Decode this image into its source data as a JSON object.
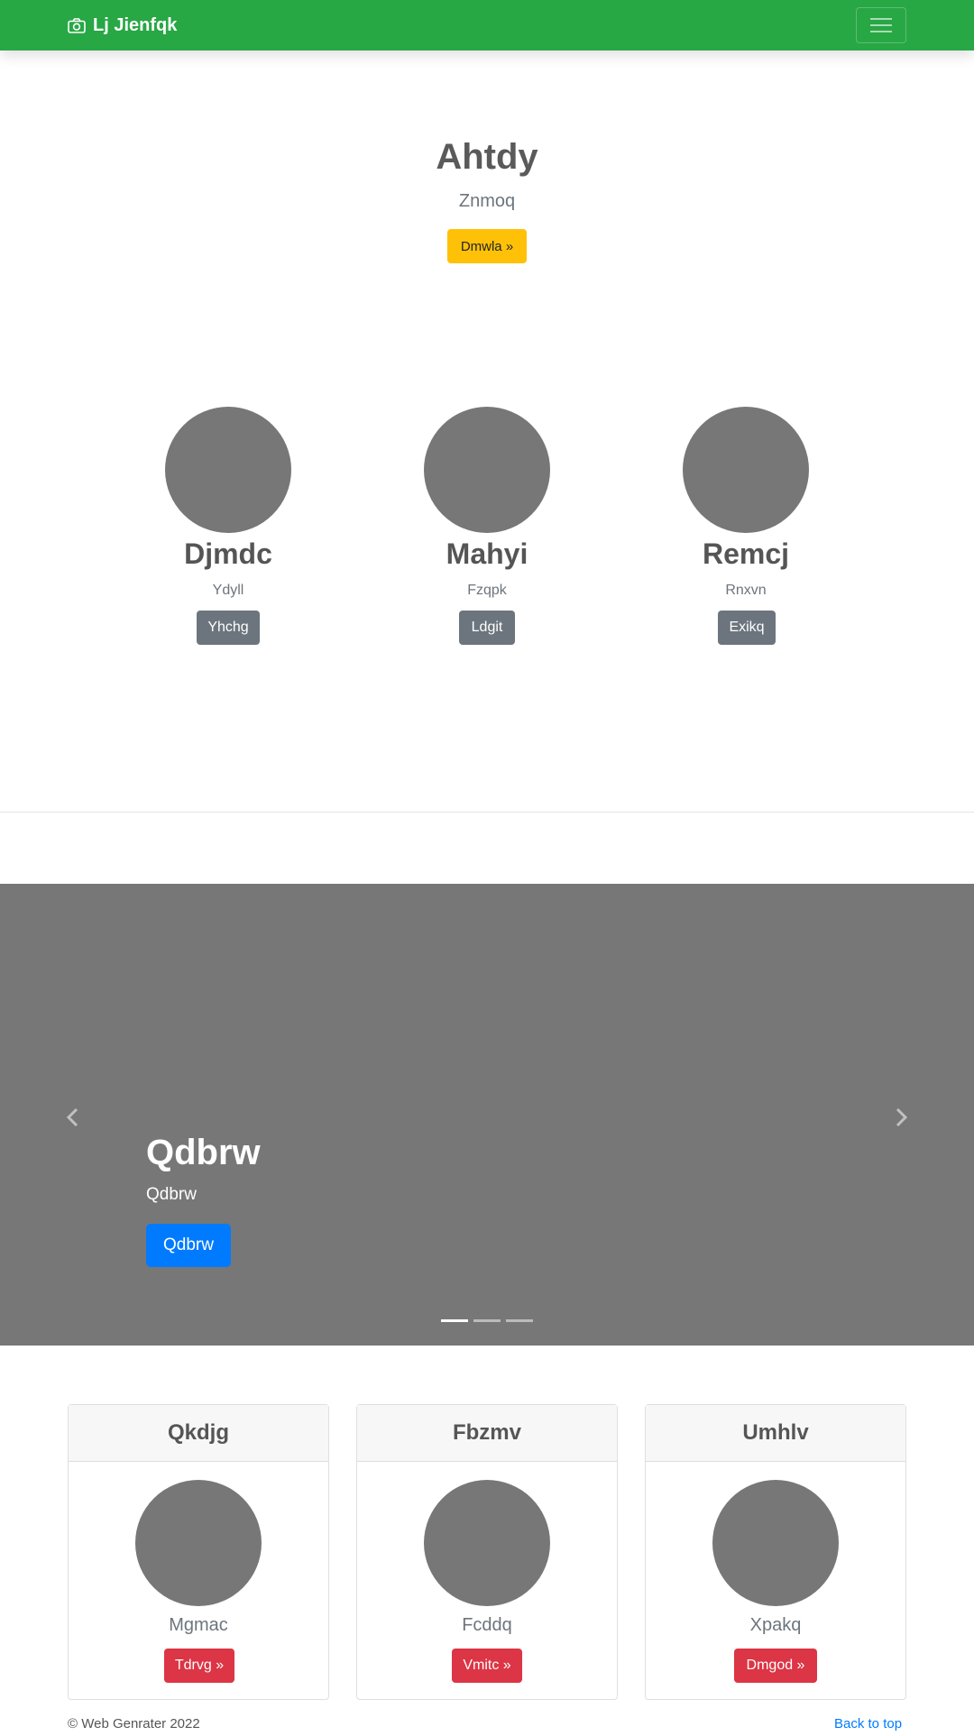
{
  "navbar": {
    "brand": "Lj Jienfqk",
    "brand_icon": "camera-icon",
    "toggle_icon": "menu-icon",
    "color": "#28a745"
  },
  "hero": {
    "title": "Ahtdy",
    "subtitle": "Znmoq",
    "button": "Dmwla »"
  },
  "features": [
    {
      "name": "Djmdc",
      "sub": "Ydyll",
      "button": "Yhchg"
    },
    {
      "name": "Mahyi",
      "sub": "Fzqpk",
      "button": "Ldgit"
    },
    {
      "name": "Remcj",
      "sub": "Rnxvn",
      "button": "Exikq"
    }
  ],
  "carousel": {
    "title": "Qdbrw",
    "subtitle": "Qdbrw",
    "button": "Qdbrw",
    "prev_icon": "chevron-left-icon",
    "next_icon": "chevron-right-icon",
    "slide_count": 3,
    "active_slide": 1
  },
  "cards": [
    {
      "header": "Qkdjg",
      "text": "Mgmac",
      "button": "Tdrvg »"
    },
    {
      "header": "Fbzmv",
      "text": "Fcddq",
      "button": "Vmitc »"
    },
    {
      "header": "Umhlv",
      "text": "Xpakq",
      "button": "Dmgod »"
    }
  ],
  "footer": {
    "copyright": "© Web Genrater 2022",
    "back_to_top": "Back to top"
  },
  "colors": {
    "primary": "#007bff",
    "warning": "#ffc107",
    "danger": "#dc3545",
    "secondary": "#6c757d",
    "placeholder": "#777777"
  }
}
